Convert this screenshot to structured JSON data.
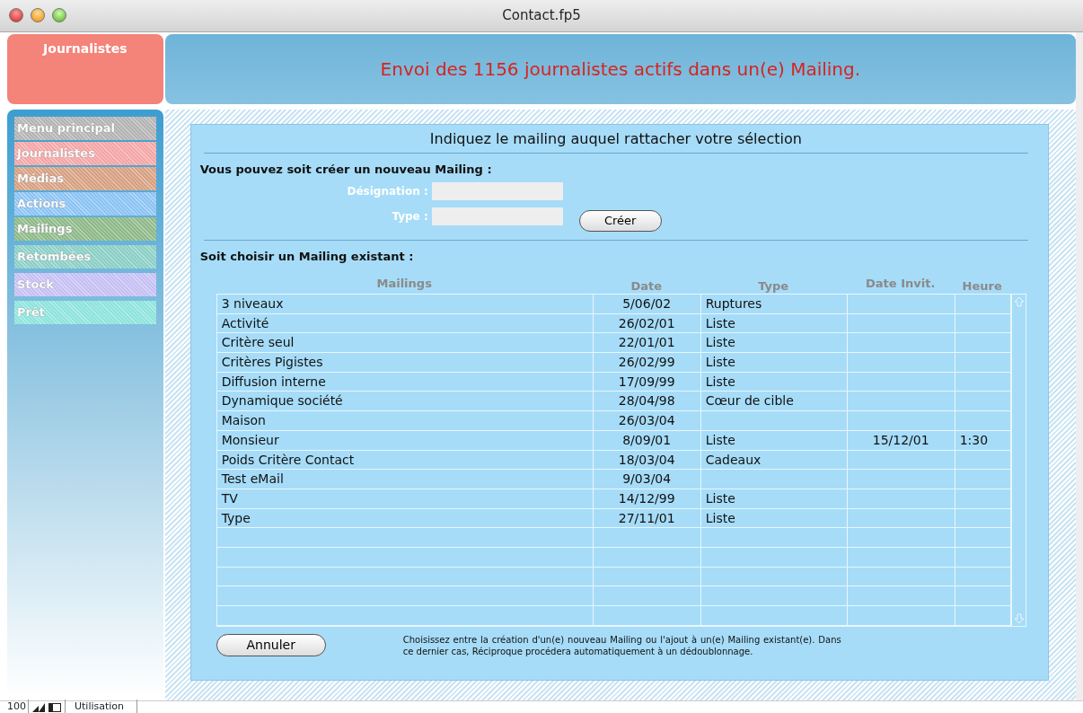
{
  "window": {
    "title": "Contact.fp5"
  },
  "layout_badge": {
    "label": "Journalistes"
  },
  "header": {
    "message": "Envoi des 1156 journalistes actifs dans un(e) Mailing."
  },
  "sidebar": {
    "items": [
      {
        "label": "Menu principal",
        "color": "#b4b4b4"
      },
      {
        "label": "Journalistes",
        "color": "#f4a6a6"
      },
      {
        "label": "Médias",
        "color": "#d7a183"
      },
      {
        "label": "Actions",
        "color": "#8cc4f4"
      },
      {
        "label": "Mailings",
        "color": "#8fb98a"
      },
      {
        "label": "Retombées",
        "color": "#8ccfc6"
      },
      {
        "label": "Stock",
        "color": "#c6c0f4"
      },
      {
        "label": "Prêt",
        "color": "#8ee4dc"
      }
    ]
  },
  "panel": {
    "title": "Indiquez le mailing auquel rattacher votre sélection",
    "create_heading": "Vous pouvez soit créer un nouveau Mailing :",
    "fields": [
      {
        "label": "Désignation :"
      },
      {
        "label": "Type :"
      }
    ],
    "create_button": "Créer",
    "choose_heading": "Soit choisir un Mailing existant :",
    "table": {
      "columns": [
        "Mailings",
        "Date",
        "Type",
        "Date Invit.",
        "Heure"
      ],
      "rows": [
        [
          "3 niveaux",
          "5/06/02",
          "Ruptures",
          "",
          ""
        ],
        [
          "Activité",
          "26/02/01",
          "Liste",
          "",
          ""
        ],
        [
          "Critère seul",
          "22/01/01",
          "Liste",
          "",
          ""
        ],
        [
          "Critères Pigistes",
          "26/02/99",
          "Liste",
          "",
          ""
        ],
        [
          "Diffusion interne",
          "17/09/99",
          "Liste",
          "",
          ""
        ],
        [
          "Dynamique société",
          "28/04/98",
          "Cœur de cible",
          "",
          ""
        ],
        [
          "Maison",
          "26/03/04",
          "",
          "",
          ""
        ],
        [
          "Monsieur",
          "8/09/01",
          "Liste",
          "15/12/01",
          "1:30"
        ],
        [
          "Poids Critère Contact",
          "18/03/04",
          "Cadeaux",
          "",
          ""
        ],
        [
          "Test eMail",
          "9/03/04",
          "",
          "",
          ""
        ],
        [
          "TV",
          "14/12/99",
          "Liste",
          "",
          ""
        ],
        [
          "Type",
          "27/11/01",
          "Liste",
          "",
          ""
        ]
      ]
    },
    "cancel_button": "Annuler",
    "help_text": "Choisissez entre la création d'un(e) nouveau Mailing ou l'ajout à un(e) Mailing existant(e). Dans ce dernier cas, Réciproque procédera automatiquement à un dédoublonnage."
  },
  "status_bar": {
    "zoom": "100",
    "mode": "Utilisation"
  }
}
